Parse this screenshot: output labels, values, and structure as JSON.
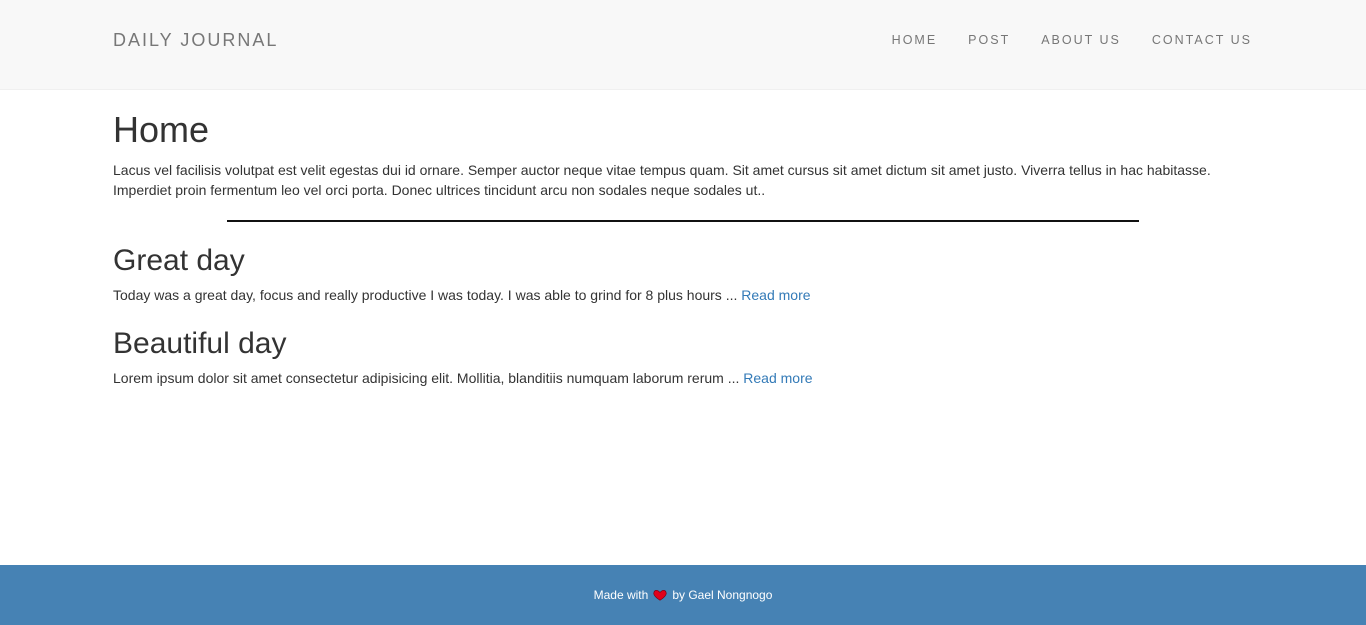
{
  "header": {
    "brand": "DAILY JOURNAL",
    "nav": [
      {
        "label": "HOME"
      },
      {
        "label": "POST"
      },
      {
        "label": "ABOUT US"
      },
      {
        "label": "CONTACT US"
      }
    ]
  },
  "main": {
    "title": "Home",
    "intro": "Lacus vel facilisis volutpat est velit egestas dui id ornare. Semper auctor neque vitae tempus quam. Sit amet cursus sit amet dictum sit amet justo. Viverra tellus in hac habitasse. Imperdiet proin fermentum leo vel orci porta. Donec ultrices tincidunt arcu non sodales neque sodales ut..",
    "posts": [
      {
        "title": "Great day",
        "excerpt": "Today was a great day, focus and really productive I was today. I was able to grind for 8 plus hours ... ",
        "read_more": "Read more"
      },
      {
        "title": "Beautiful day",
        "excerpt": "Lorem ipsum dolor sit amet consectetur adipisicing elit. Mollitia, blanditiis numquam laborum rerum ... ",
        "read_more": "Read more"
      }
    ]
  },
  "footer": {
    "made_with": "Made with",
    "by": "by Gael Nongnogo",
    "heart_icon": "heart-icon"
  },
  "colors": {
    "navbar_bg": "#f8f8f8",
    "footer_bg": "#4682b4",
    "link": "#337ab7",
    "heart": "#e0001a"
  }
}
